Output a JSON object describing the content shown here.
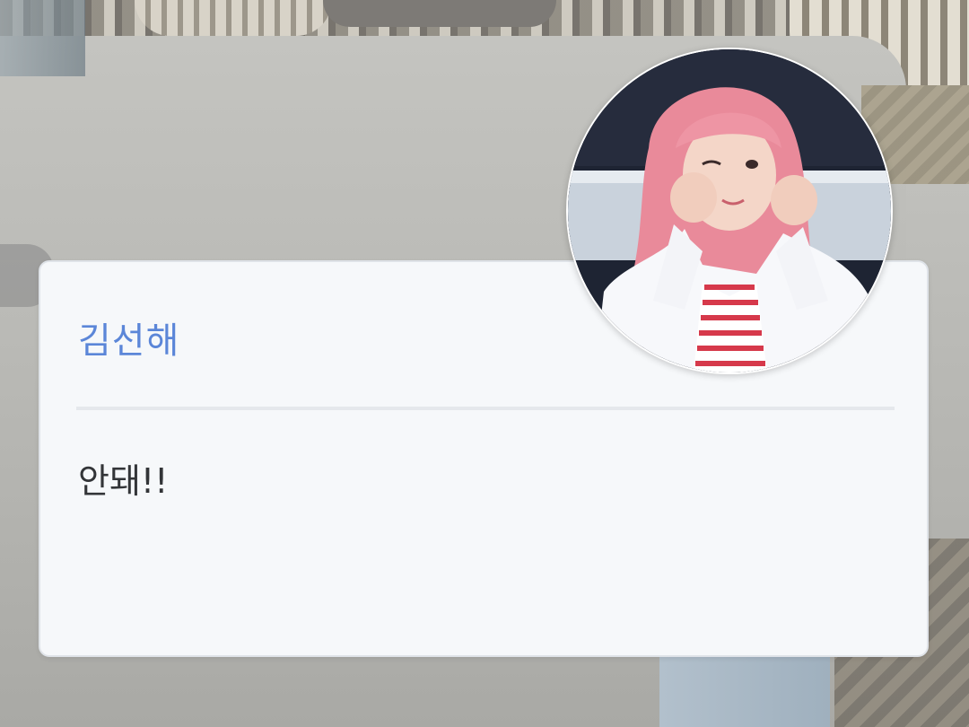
{
  "dialog": {
    "speaker_name": "김선해",
    "message": "안돼!!"
  },
  "avatar": {
    "icon": "character-portrait"
  },
  "colors": {
    "name_text": "#5b86d8",
    "message_text": "#333538",
    "card_background": "#f6f8fa"
  }
}
